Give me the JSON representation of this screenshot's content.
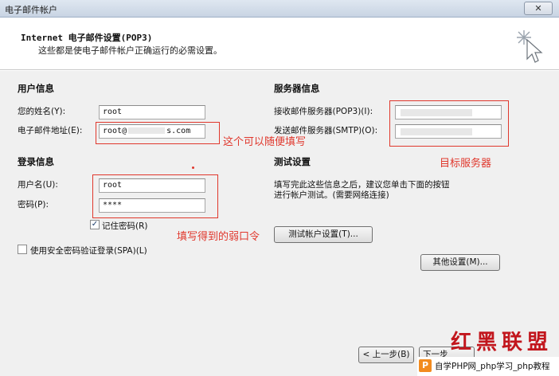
{
  "window": {
    "title": "电子邮件帐户",
    "close_glyph": "✕"
  },
  "header": {
    "title": "Internet 电子邮件设置(POP3)",
    "subtitle": "这些都是使电子邮件帐户正确运行的必需设置。",
    "icon": "wizard-sparkle-icon"
  },
  "user_info": {
    "heading": "用户信息",
    "name_label": "您的姓名(Y):",
    "name_value": "root",
    "email_label": "电子邮件地址(E):",
    "email_value": "root@",
    "email_suffix": "s.com"
  },
  "server_info": {
    "heading": "服务器信息",
    "incoming_label": "接收邮件服务器(POP3)(I):",
    "outgoing_label": "发送邮件服务器(SMTP)(O):"
  },
  "login_info": {
    "heading": "登录信息",
    "username_label": "用户名(U):",
    "username_value": "root",
    "password_label": "密码(P):",
    "password_value": "****",
    "remember_label": "记住密码(R)",
    "remember_checked": true,
    "spa_label": "使用安全密码验证登录(SPA)(L)",
    "spa_checked": false
  },
  "test_settings": {
    "heading": "测试设置",
    "description_line1": "填写完此这些信息之后，建议您单击下面的按钮",
    "description_line2": "进行帐户测试。(需要网络连接)",
    "test_button": "测试帐户设置(T)...",
    "more_settings_button": "其他设置(M)..."
  },
  "nav": {
    "back_button": "< 上一步(B)",
    "next_button": "下一步"
  },
  "annotations": {
    "email_note": "这个可以随便填写",
    "server_note": "目标服务器",
    "password_note": "填写得到的弱口令",
    "color": "#e0372c"
  },
  "watermark": {
    "brand": "红黑联盟",
    "logo_letter": "P",
    "site_text": "自学PHP网_php学习_php教程"
  }
}
